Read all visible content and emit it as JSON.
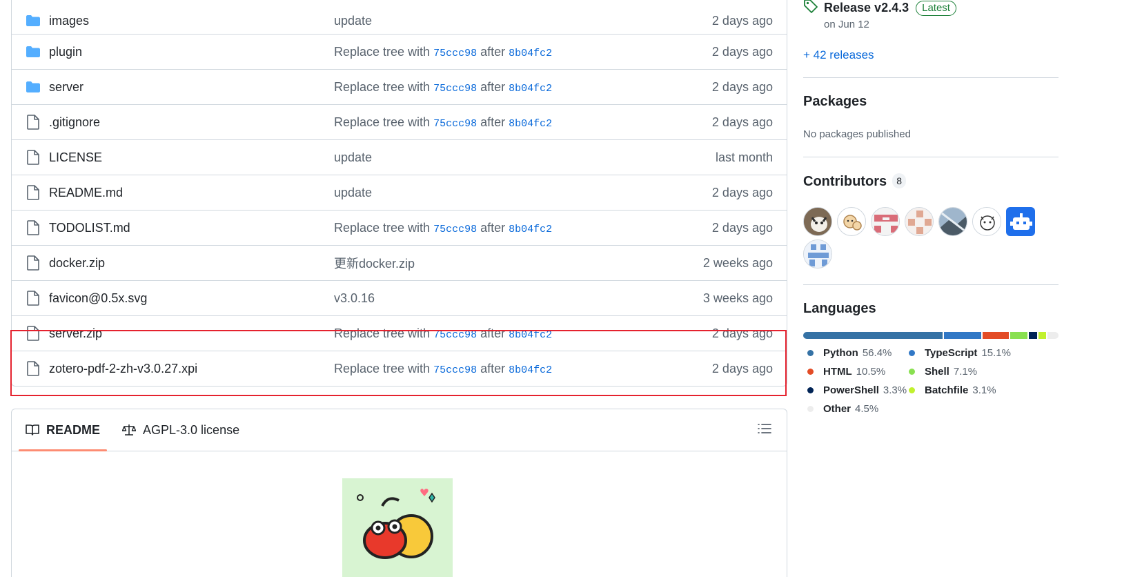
{
  "files": [
    {
      "name": "images",
      "type": "folder",
      "message": "update",
      "date": "2 days ago"
    },
    {
      "name": "plugin",
      "type": "folder",
      "message_prefix": "Replace tree with",
      "sha1": "75ccc98",
      "message_mid": "after",
      "sha2": "8b04fc2",
      "date": "2 days ago"
    },
    {
      "name": "server",
      "type": "folder",
      "message_prefix": "Replace tree with",
      "sha1": "75ccc98",
      "message_mid": "after",
      "sha2": "8b04fc2",
      "date": "2 days ago"
    },
    {
      "name": ".gitignore",
      "type": "file",
      "message_prefix": "Replace tree with",
      "sha1": "75ccc98",
      "message_mid": "after",
      "sha2": "8b04fc2",
      "date": "2 days ago"
    },
    {
      "name": "LICENSE",
      "type": "file",
      "message": "update",
      "date": "last month"
    },
    {
      "name": "README.md",
      "type": "file",
      "message": "update",
      "date": "2 days ago"
    },
    {
      "name": "TODOLIST.md",
      "type": "file",
      "message_prefix": "Replace tree with",
      "sha1": "75ccc98",
      "message_mid": "after",
      "sha2": "8b04fc2",
      "date": "2 days ago"
    },
    {
      "name": "docker.zip",
      "type": "file",
      "message": "更新docker.zip",
      "date": "2 weeks ago"
    },
    {
      "name": "favicon@0.5x.svg",
      "type": "file",
      "message": "v3.0.16",
      "date": "3 weeks ago"
    },
    {
      "name": "server.zip",
      "type": "file",
      "message_prefix": "Replace tree with",
      "sha1": "75ccc98",
      "message_mid": "after",
      "sha2": "8b04fc2",
      "date": "2 days ago"
    },
    {
      "name": "zotero-pdf-2-zh-v3.0.27.xpi",
      "type": "file",
      "message_prefix": "Replace tree with",
      "sha1": "75ccc98",
      "message_mid": "after",
      "sha2": "8b04fc2",
      "date": "2 days ago"
    }
  ],
  "readme": {
    "tabs": [
      {
        "label": "README",
        "icon": "book-icon",
        "active": true
      },
      {
        "label": "AGPL-3.0 license",
        "icon": "law-icon",
        "active": false
      }
    ]
  },
  "sidebar": {
    "release": {
      "name": "Release v2.4.3",
      "badge": "Latest",
      "date": "on Jun 12",
      "more_link": "+ 42 releases"
    },
    "packages": {
      "title": "Packages",
      "text": "No packages published"
    },
    "contributors": {
      "title": "Contributors",
      "count": "8"
    },
    "languages": {
      "title": "Languages",
      "items": [
        {
          "name": "Python",
          "pct": "56.4%",
          "value": 56.4,
          "color": "#3572A5"
        },
        {
          "name": "TypeScript",
          "pct": "15.1%",
          "value": 15.1,
          "color": "#3178c6"
        },
        {
          "name": "HTML",
          "pct": "10.5%",
          "value": 10.5,
          "color": "#e34c26"
        },
        {
          "name": "Shell",
          "pct": "7.1%",
          "value": 7.1,
          "color": "#89e051"
        },
        {
          "name": "PowerShell",
          "pct": "3.3%",
          "value": 3.3,
          "color": "#012456"
        },
        {
          "name": "Batchfile",
          "pct": "3.1%",
          "value": 3.1,
          "color": "#C1F12E"
        },
        {
          "name": "Other",
          "pct": "4.5%",
          "value": 4.5,
          "color": "#ededed"
        }
      ]
    }
  },
  "colors": {
    "accent": "#0969da",
    "highlight": "#e5222e",
    "tab_underline": "#fd8c73"
  }
}
